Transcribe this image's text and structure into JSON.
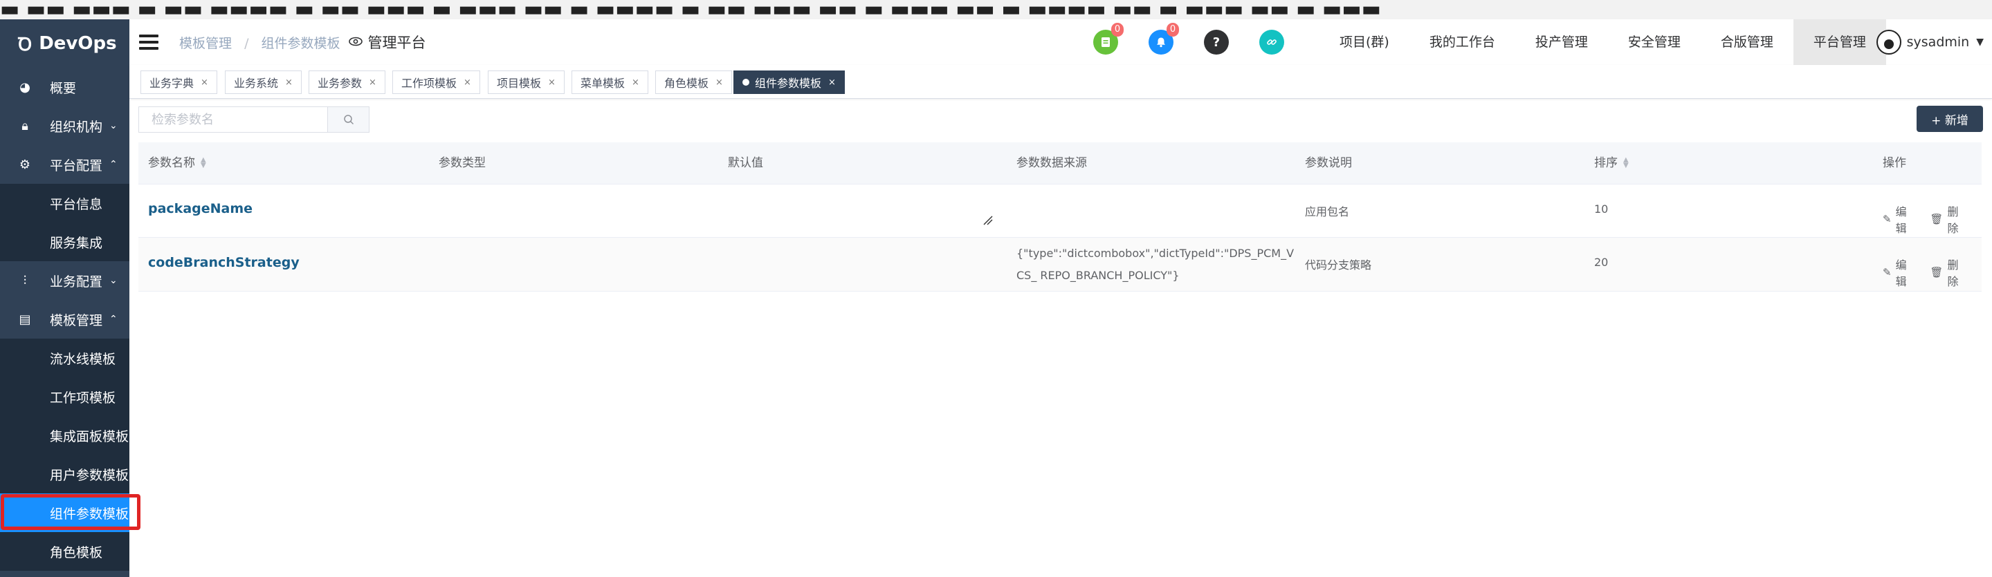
{
  "sidebar": {
    "logo": "DevOps",
    "items": [
      {
        "label": "概要",
        "icon": "dashboard-icon",
        "type": "top"
      },
      {
        "label": "组织机构",
        "icon": "lock-icon",
        "type": "top",
        "arrow": "chevron-down-icon"
      },
      {
        "label": "平台配置",
        "icon": "gear-icon",
        "type": "top",
        "arrow": "chevron-up-icon"
      },
      {
        "label": "平台信息",
        "type": "sub"
      },
      {
        "label": "服务集成",
        "type": "sub"
      },
      {
        "label": "业务配置",
        "icon": "sliders-icon",
        "type": "top",
        "arrow": "chevron-down-icon"
      },
      {
        "label": "模板管理",
        "icon": "template-icon",
        "type": "top",
        "arrow": "chevron-up-icon"
      },
      {
        "label": "流水线模板",
        "type": "sub"
      },
      {
        "label": "工作项模板",
        "type": "sub"
      },
      {
        "label": "集成面板模板",
        "type": "sub"
      },
      {
        "label": "用户参数模板",
        "type": "sub"
      },
      {
        "label": "组件参数模板",
        "type": "sub",
        "active": true
      },
      {
        "label": "角色模板",
        "type": "sub"
      }
    ]
  },
  "header": {
    "breadcrumb": [
      "模板管理",
      "组件参数模板"
    ],
    "platform_label": "管理平台",
    "icons": [
      {
        "name": "document-icon",
        "color": "#67c23a",
        "badge": "0"
      },
      {
        "name": "bell-icon",
        "color": "#1890ff",
        "badge": "0"
      },
      {
        "name": "help-icon",
        "color": "#303133"
      },
      {
        "name": "link-icon",
        "color": "#13c2c2"
      }
    ],
    "nav": [
      "项目(群)",
      "我的工作台",
      "投产管理",
      "安全管理",
      "合版管理",
      "平台管理"
    ],
    "active_nav": "平台管理",
    "user": "sysadmin"
  },
  "tags": [
    "业务字典",
    "业务系统",
    "业务参数",
    "工作项模板",
    "项目模板",
    "菜单模板",
    "角色模板",
    "组件参数模板"
  ],
  "active_tag": "组件参数模板",
  "search": {
    "placeholder": "检索参数名"
  },
  "add_button": "+ 新增",
  "table": {
    "columns": [
      "参数名称",
      "参数类型",
      "默认值",
      "参数数据来源",
      "参数说明",
      "排序",
      "操作"
    ],
    "rows": [
      {
        "name": "packageName",
        "type": "",
        "default": "",
        "source": "",
        "desc": "应用包名",
        "order": "10"
      },
      {
        "name": "codeBranchStrategy",
        "type": "",
        "default": "",
        "source": "{\"type\":\"dictcombobox\",\"dictTypeId\":\"DPS_PCM_VCS_ REPO_BRANCH_POLICY\"}",
        "desc": "代码分支策略",
        "order": "20"
      }
    ],
    "actions": {
      "edit": "编辑",
      "delete": "删除"
    }
  }
}
